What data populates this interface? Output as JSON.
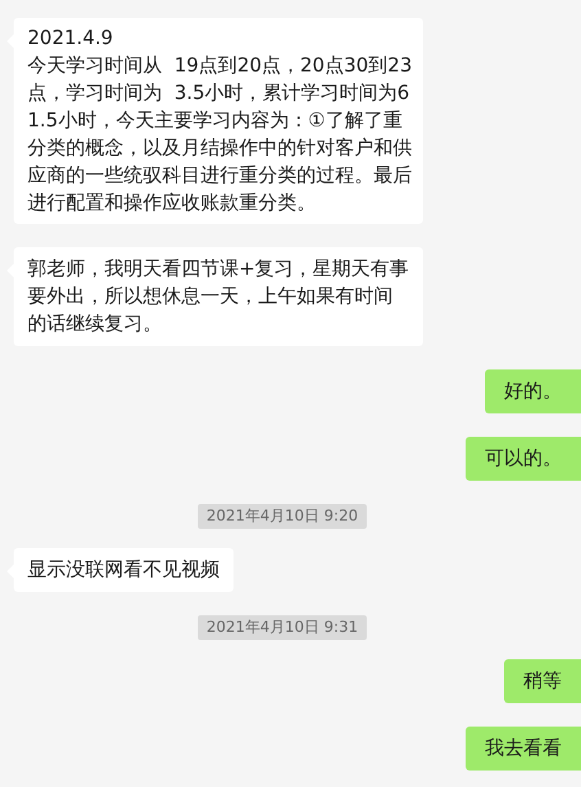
{
  "messages": [
    {
      "kind": "received",
      "text": "2021.4.9\n今天学习时间从  19点到20点，20点30到23点，学习时间为  3.5小时，累计学习时间为61.5小时，今天主要学习内容为：①了解了重分类的概念，以及月结操作中的针对客户和供应商的一些统驭科目进行重分类的过程。最后进行配置和操作应收账款重分类。"
    },
    {
      "kind": "received",
      "text": "郭老师，我明天看四节课+复习，星期天有事要外出，所以想休息一天，上午如果有时间的话继续复习。"
    },
    {
      "kind": "sent",
      "text": "好的。"
    },
    {
      "kind": "sent",
      "text": "可以的。"
    },
    {
      "kind": "timestamp",
      "text": "2021年4月10日 9:20"
    },
    {
      "kind": "received",
      "text": "显示没联网看不见视频"
    },
    {
      "kind": "timestamp",
      "text": "2021年4月10日 9:31"
    },
    {
      "kind": "sent",
      "text": "稍等"
    },
    {
      "kind": "sent",
      "text": "我去看看"
    }
  ]
}
